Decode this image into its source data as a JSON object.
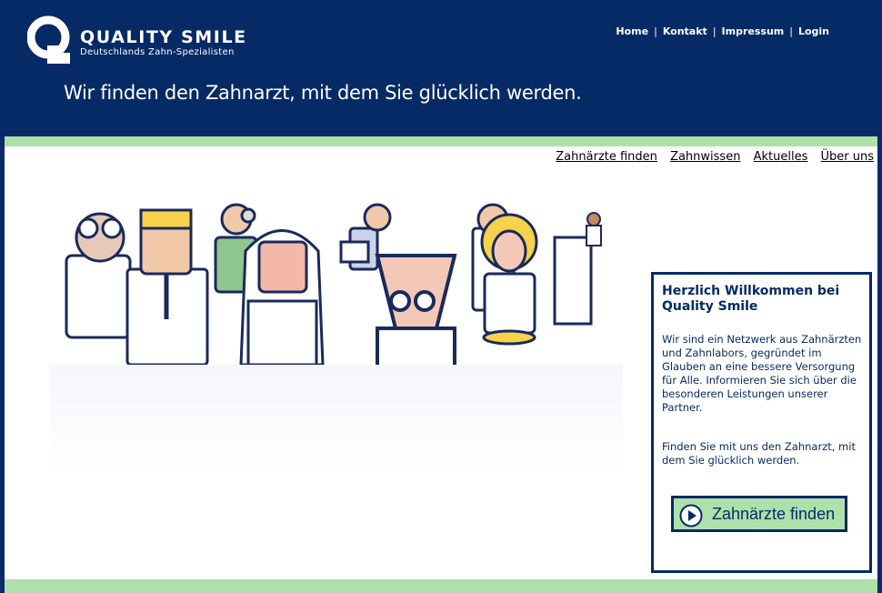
{
  "brand": {
    "name": "QUALITY SMILE",
    "subtitle": "Deutschlands Zahn-Spezialisten",
    "letter": "Q"
  },
  "topnav": {
    "items": [
      "Home",
      "Kontakt",
      "Impressum",
      "Login"
    ],
    "separator": "|"
  },
  "tagline": "Wir finden den Zahnarzt, mit dem Sie glücklich werden.",
  "subnav": {
    "items": [
      "Zahnärzte finden",
      "Zahnwissen",
      "Aktuelles",
      "Über uns"
    ]
  },
  "welcome": {
    "title": "Herzlich Willkommen bei Quality Smile",
    "paragraph1": "Wir sind ein Netzwerk aus Zahnärzten und Zahnlabors, gegründet im Glauben an eine bessere Versorgung für Alle. Informieren Sie sich über die besonderen Leistungen unserer Partner.",
    "paragraph2": "Finden Sie mit uns den Zahnarzt, mit dem Sie glücklich werden.",
    "cta_label": "Zahnärzte finden"
  },
  "colors": {
    "navy": "#062a66",
    "green": "#aee0aa",
    "white": "#ffffff"
  }
}
